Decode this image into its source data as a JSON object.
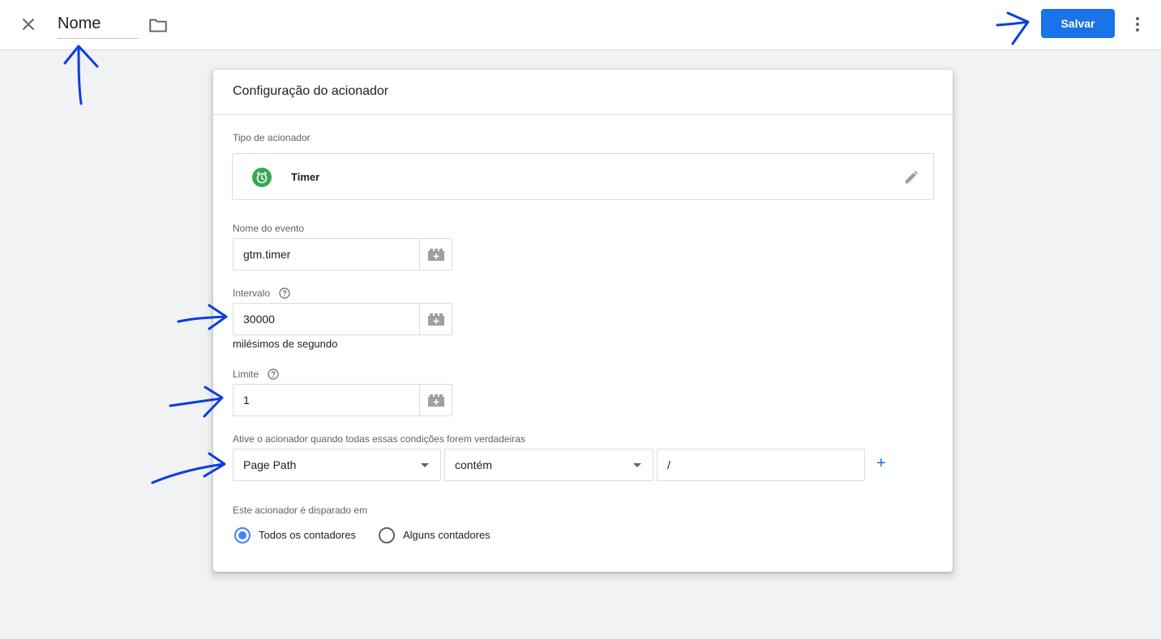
{
  "header": {
    "name_value": "Nome",
    "save_label": "Salvar",
    "icons": {
      "close": "close-icon",
      "folder": "folder-icon",
      "more": "more-vert-icon"
    }
  },
  "card": {
    "title": "Configuração do acionador",
    "trigger_type": {
      "label": "Tipo de acionador",
      "name": "Timer",
      "icon": "alarm-clock-icon",
      "icon_color": "#34a853"
    },
    "event_name": {
      "label": "Nome do evento",
      "value": "gtm.timer"
    },
    "interval": {
      "label": "Intervalo",
      "value": "30000",
      "hint": "milésimos de segundo"
    },
    "limit": {
      "label": "Limite",
      "value": "1"
    },
    "conditions": {
      "label": "Ative o acionador quando todas essas condições forem verdadeiras",
      "variable": "Page Path",
      "operator": "contém",
      "value": "/",
      "add_label": "+"
    },
    "fires_on": {
      "label": "Este acionador é disparado em",
      "options": [
        {
          "label": "Todos os contadores",
          "checked": true
        },
        {
          "label": "Alguns contadores",
          "checked": false
        }
      ]
    }
  },
  "colors": {
    "accent": "#1a73e8",
    "annotation": "#0b3ee0"
  }
}
